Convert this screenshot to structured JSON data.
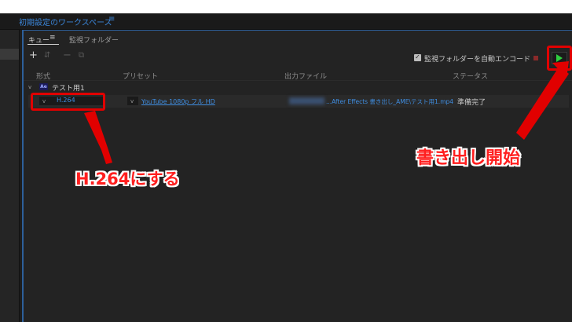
{
  "window": {
    "workspace_title": "初期設定のワークスペース",
    "workspace_menu_icon": "≡"
  },
  "panel": {
    "tabs": [
      {
        "label": "キュー",
        "menu": "≡"
      },
      {
        "label": "監視フォルダー"
      }
    ],
    "toolbar": {
      "add": "+",
      "settings": "⇵",
      "remove": "−",
      "duplicate": "⧉",
      "watch_checkbox_checked": true,
      "watch_checkbox_mark": "✓",
      "watch_label": "監視フォルダーを自動エンコード"
    },
    "columns": [
      "形式",
      "プリセット",
      "出力ファイル",
      "ステータス"
    ],
    "group": {
      "chevron": "v",
      "app_badge": "Ae",
      "name": "テスト用1"
    },
    "item": {
      "chevron_format": "v",
      "format": "H.264",
      "chevron_preset": "v",
      "preset": "YouTube 1080p フル HD",
      "output": "...After Effects 書き出し_AME\\テスト用1.mp4",
      "status": "準備完了"
    }
  },
  "annotations": {
    "format_callout": "H.264にする",
    "start_callout": "書き出し開始",
    "color": "#ff1f1f"
  },
  "colors": {
    "link": "#3f8de0",
    "play": "#2fcf3f",
    "highlight": "#e10000"
  }
}
